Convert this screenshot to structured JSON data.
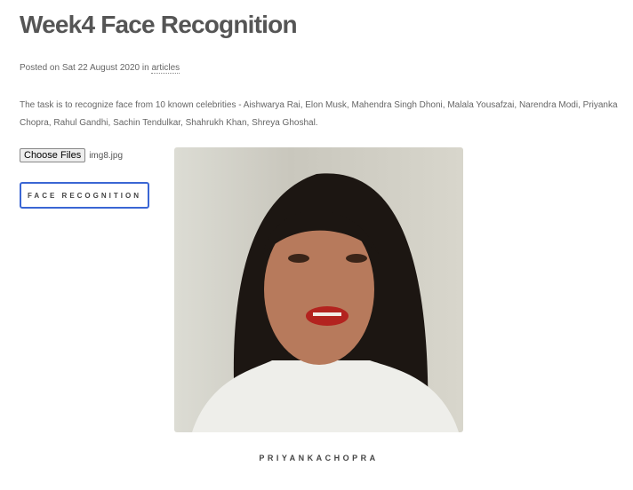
{
  "title": "Week4 Face Recognition",
  "meta": {
    "prefix": "Posted on Sat 22 August 2020 in",
    "category": "articles"
  },
  "description": "The task is to recognize face from 10 known celebrities - Aishwarya Rai, Elon Musk, Mahendra Singh Dhoni, Malala Yousafzai, Narendra Modi, Priyanka Chopra, Rahul Gandhi, Sachin Tendulkar, Shahrukh Khan, Shreya Ghoshal.",
  "file": {
    "button": "Choose Files",
    "filename": "img8.jpg"
  },
  "action": "FACE RECOGNITION",
  "result": "PRIYANKACHOPRA"
}
